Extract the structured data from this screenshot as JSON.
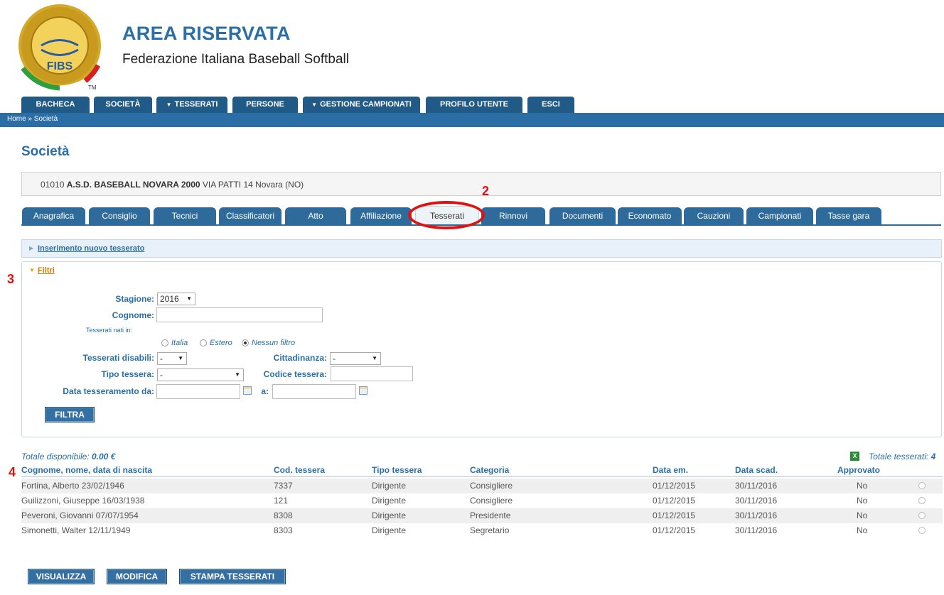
{
  "header": {
    "logo_text": [
      "FEDERAZIONE ITALIANA BASEBALL SOFTBALL",
      "FIBS",
      "TM"
    ],
    "title": "AREA RISERVATA",
    "subtitle": "Federazione Italiana Baseball Softball"
  },
  "mainnav": {
    "items": [
      {
        "label": "BACHECA",
        "has_dropdown": false
      },
      {
        "label": "SOCIETÀ",
        "has_dropdown": false
      },
      {
        "label": "TESSERATI",
        "has_dropdown": true
      },
      {
        "label": "PERSONE",
        "has_dropdown": false
      },
      {
        "label": "GESTIONE CAMPIONATI",
        "has_dropdown": true
      },
      {
        "label": "PROFILO UTENTE",
        "has_dropdown": false
      },
      {
        "label": "ESCI",
        "has_dropdown": false
      }
    ],
    "dropdown_glyph": "▼",
    "breadcrumb": "Home » Società"
  },
  "page_title": "Società",
  "club": {
    "code": "01010",
    "name": "A.S.D. BASEBALL NOVARA 2000",
    "address": "VIA PATTI 14 Novara (NO)"
  },
  "subtabs": {
    "items": [
      "Anagrafica",
      "Consiglio",
      "Tecnici",
      "Classificatori",
      "Atto",
      "Affiliazione",
      "Tesserati",
      "Rinnovi",
      "Documenti",
      "Economato",
      "Cauzioni",
      "Campionati",
      "Tasse gara"
    ],
    "active": "Tesserati"
  },
  "annotations": {
    "m2": "2",
    "m3": "3",
    "m4": "4"
  },
  "accordion": {
    "new_member": "Inserimento nuovo tesserato",
    "filters": "Filtri"
  },
  "filters": {
    "stagione_label": "Stagione:",
    "stagione_value": "2016",
    "cognome_label": "Cognome:",
    "cognome_value": "",
    "nati_label": "Tesserati nati in:",
    "radio_italia": "Italia",
    "radio_estero": "Estero",
    "radio_nessuno": "Nessun filtro",
    "radio_selected": "Nessun filtro",
    "disabili_label": "Tesserati disabili:",
    "disabili_value": "-",
    "cittadinanza_label": "Cittadinanza:",
    "cittadinanza_value": "-",
    "tipo_label": "Tipo tessera:",
    "tipo_value": "-",
    "codice_label": "Codice tessera:",
    "codice_value": "",
    "data_da_label": "Data tesseramento da:",
    "data_a_label": "a:",
    "filtra_button": "FILTRA"
  },
  "table": {
    "totale_disponibile_label": "Totale disponibile:",
    "totale_disponibile_value": "0.00 €",
    "totale_tesserati_label": "Totale tesserati:",
    "totale_tesserati_value": "4",
    "excel_icon": "X",
    "columns": [
      "Cognome, nome, data di nascita",
      "Cod. tessera",
      "Tipo tessera",
      "Categoria",
      "Data em.",
      "Data scad.",
      "Approvato"
    ],
    "rows": [
      {
        "nome": "Fortina, Alberto 23/02/1946",
        "cod": "7337",
        "tipo": "Dirigente",
        "cat": "Consigliere",
        "em": "01/12/2015",
        "scad": "30/11/2016",
        "appr": "No"
      },
      {
        "nome": "Guilizzoni, Giuseppe 16/03/1938",
        "cod": "121",
        "tipo": "Dirigente",
        "cat": "Consigliere",
        "em": "01/12/2015",
        "scad": "30/11/2016",
        "appr": "No"
      },
      {
        "nome": "Peveroni, Giovanni 07/07/1954",
        "cod": "8308",
        "tipo": "Dirigente",
        "cat": "Presidente",
        "em": "01/12/2015",
        "scad": "30/11/2016",
        "appr": "No"
      },
      {
        "nome": "Simonetti, Walter 12/11/1949",
        "cod": "8303",
        "tipo": "Dirigente",
        "cat": "Segretario",
        "em": "01/12/2015",
        "scad": "30/11/2016",
        "appr": "No"
      }
    ]
  },
  "actions": {
    "visualizza": "VISUALIZZA",
    "modifica": "MODIFICA",
    "stampa": "STAMPA TESSERATI"
  },
  "colors": {
    "brand_blue": "#2a6fa5",
    "nav_dark": "#225a87",
    "annotation_red": "#e01010"
  }
}
